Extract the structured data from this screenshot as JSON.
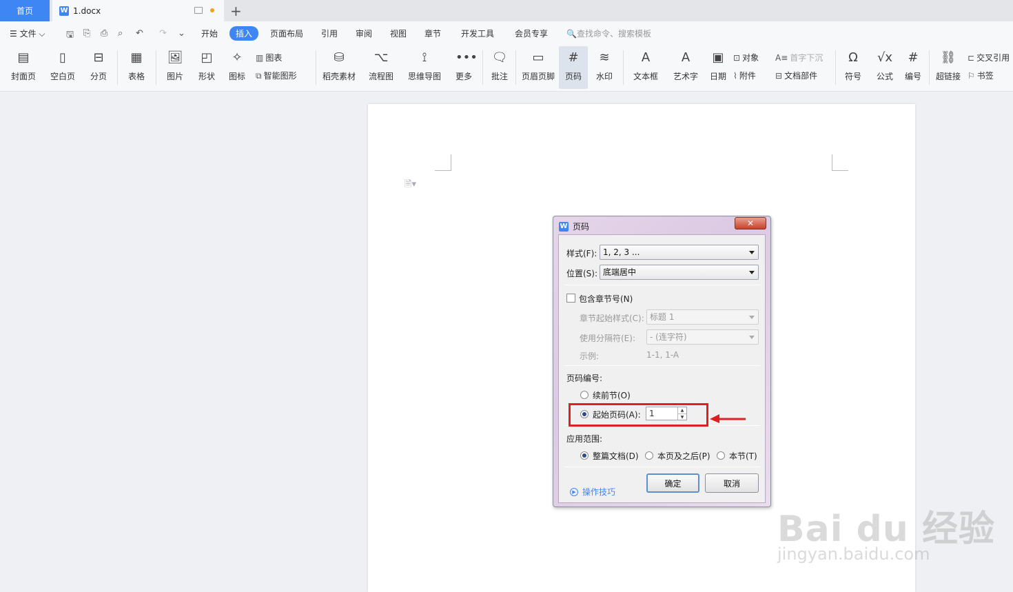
{
  "tabs": {
    "home": "首页",
    "doc": "1.docx",
    "add": "+"
  },
  "menu": {
    "file": "☰ 文件 ⌵",
    "tabs": [
      "开始",
      "插入",
      "页面布局",
      "引用",
      "审阅",
      "视图",
      "章节",
      "开发工具",
      "会员专享"
    ],
    "active": "插入",
    "search": "🔍查找命令、搜索模板"
  },
  "ribbon": {
    "cover": "封面页",
    "blank": "空白页",
    "pagebreak": "分页",
    "table": "表格",
    "picture": "图片",
    "shape": "形状",
    "icons": "图标",
    "chart": "图表",
    "smartart": "智能图形",
    "material": "稻壳素材",
    "flowchart": "流程图",
    "mindmap": "思维导图",
    "more": "更多",
    "comment": "批注",
    "headerfooter": "页眉页脚",
    "pagenum": "页码",
    "watermark": "水印",
    "textbox": "文本框",
    "wordart": "艺术字",
    "date": "日期",
    "object": "对象",
    "attach": "附件",
    "dropcap": "首字下沉",
    "docparts": "文档部件",
    "symbol": "符号",
    "formula": "公式",
    "numbering": "编号",
    "hyperlink": "超链接",
    "crossref": "交叉引用",
    "bookmark": "书签"
  },
  "dialog": {
    "title": "页码",
    "style_label": "样式(F):",
    "style_value": "1, 2, 3 ...",
    "position_label": "位置(S):",
    "position_value": "底端居中",
    "include_chapter": "包含章节号(N)",
    "chapter_style_label": "章节起始样式(C):",
    "chapter_style_value": "标题 1",
    "separator_label": "使用分隔符(E):",
    "separator_value": "-    (连字符)",
    "example_label": "示例:",
    "example_value": "1-1, 1-A",
    "numbering_label": "页码编号:",
    "continue_prev": "续前节(O)",
    "start_at": "起始页码(A):",
    "start_value": "1",
    "apply_label": "应用范围:",
    "apply_whole": "整篇文档(D)",
    "apply_after": "本页及之后(P)",
    "apply_section": "本节(T)",
    "tips": "操作技巧",
    "ok": "确定",
    "cancel": "取消"
  },
  "watermark": {
    "brand": "Bai du 经验",
    "url": "jingyan.baidu.com"
  },
  "colors": {
    "accent": "#3f86f5",
    "highlight": "#e02020"
  }
}
